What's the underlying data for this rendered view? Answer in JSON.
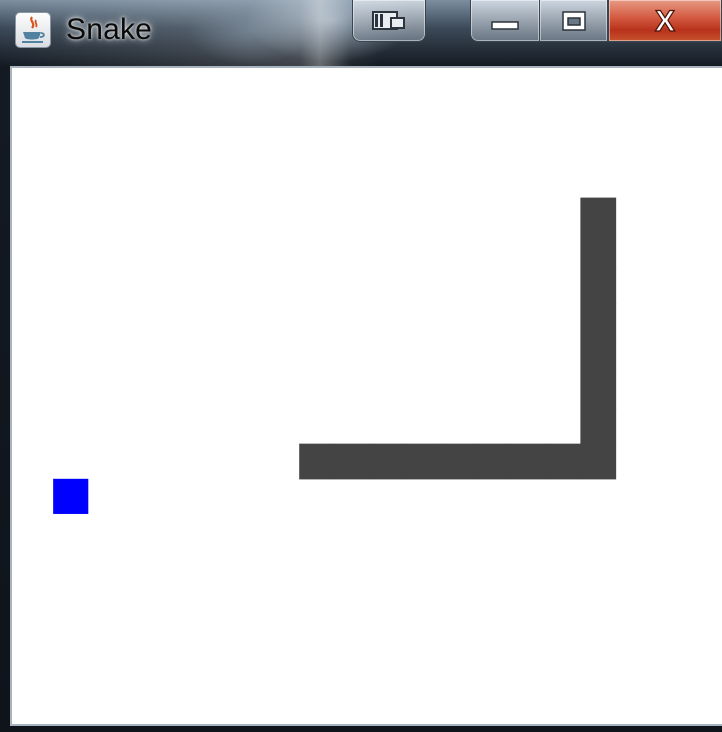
{
  "window": {
    "title": "Snake",
    "icon": "java-cup-icon"
  },
  "caption_buttons": {
    "extra": "window-switch-icon",
    "minimize": "minimize-icon",
    "maximize": "maximize-icon",
    "close": "close-icon",
    "close_label": "X"
  },
  "game": {
    "background_color": "#ffffff",
    "snake_color": "#444444",
    "food_color": "#0000ff",
    "snake_segments": [
      {
        "col": 8,
        "row": 11
      },
      {
        "col": 9,
        "row": 11
      },
      {
        "col": 10,
        "row": 11
      },
      {
        "col": 11,
        "row": 11
      },
      {
        "col": 12,
        "row": 11
      },
      {
        "col": 13,
        "row": 11
      },
      {
        "col": 14,
        "row": 11
      },
      {
        "col": 15,
        "row": 11
      },
      {
        "col": 16,
        "row": 11
      },
      {
        "col": 16,
        "row": 10
      },
      {
        "col": 16,
        "row": 9
      },
      {
        "col": 16,
        "row": 8
      },
      {
        "col": 16,
        "row": 7
      },
      {
        "col": 16,
        "row": 6
      },
      {
        "col": 16,
        "row": 5
      },
      {
        "col": 16,
        "row": 4
      }
    ],
    "food": {
      "col": 1,
      "row": 12
    }
  }
}
